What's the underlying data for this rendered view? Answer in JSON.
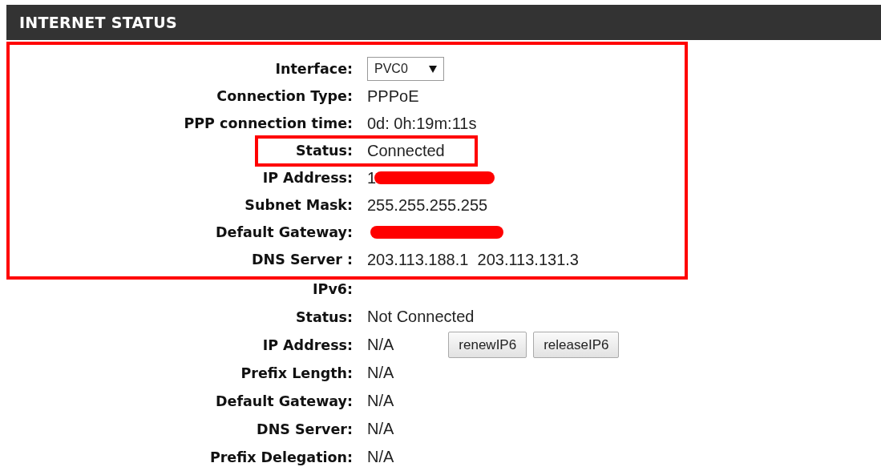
{
  "header": {
    "title": "INTERNET STATUS"
  },
  "sections": [
    {
      "highlight": true,
      "rows": [
        {
          "kind": "select",
          "label": "Interface:",
          "value": "PVC0",
          "highlighted": false
        },
        {
          "kind": "text",
          "label": "Connection Type:",
          "value": "PPPoE",
          "highlighted": false
        },
        {
          "kind": "text",
          "label": "PPP connection time:",
          "value": "0d: 0h:19m:11s",
          "highlighted": false
        },
        {
          "kind": "text",
          "label": "Status:",
          "value": "Connected",
          "highlighted": true
        },
        {
          "kind": "redacted",
          "label": "IP Address:",
          "value": "1",
          "highlighted": false
        },
        {
          "kind": "text",
          "label": "Subnet Mask:",
          "value": "255.255.255.255",
          "highlighted": false
        },
        {
          "kind": "redacted",
          "label": "Default Gateway:",
          "highlighted": false
        },
        {
          "kind": "text",
          "label": "DNS Server :",
          "value": "203.113.188.1  203.113.131.3",
          "highlighted": false
        }
      ]
    },
    {
      "highlight": false,
      "rows": [
        {
          "kind": "heading",
          "label": "IPv6:",
          "highlighted": false
        },
        {
          "kind": "text",
          "label": "Status:",
          "value": "Not Connected",
          "highlighted": false
        },
        {
          "kind": "text",
          "label": "IP Address:",
          "value": "N/A",
          "buttons": [
            "renewIP6",
            "releaseIP6"
          ],
          "highlighted": false
        },
        {
          "kind": "text",
          "label": "Prefix Length:",
          "value": "N/A",
          "highlighted": false
        },
        {
          "kind": "text",
          "label": "Default Gateway:",
          "value": "N/A",
          "highlighted": false
        },
        {
          "kind": "text",
          "label": "DNS Server:",
          "value": "N/A",
          "highlighted": false
        },
        {
          "kind": "text",
          "label": "Prefix Delegation:",
          "value": "N/A",
          "highlighted": false
        }
      ]
    }
  ]
}
